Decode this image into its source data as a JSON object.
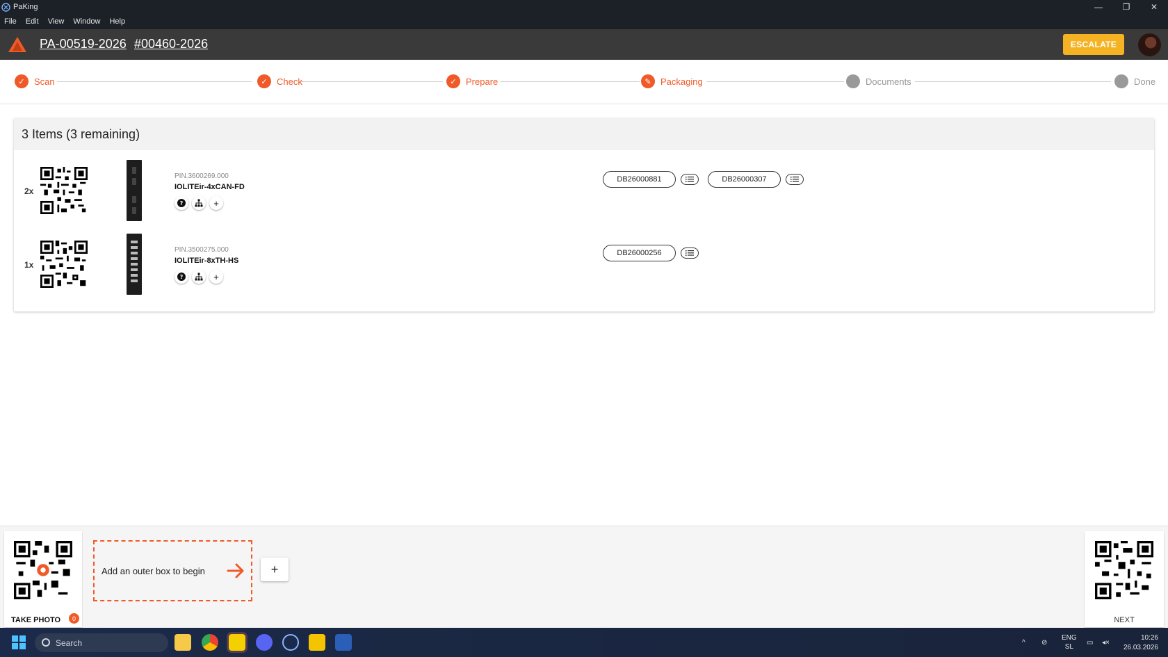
{
  "window": {
    "title": "PaKing",
    "minimize": "—",
    "restore": "❐",
    "close": "✕"
  },
  "menu": [
    "File",
    "Edit",
    "View",
    "Window",
    "Help"
  ],
  "header": {
    "order_id": "PA-00519-2026",
    "ticket_id": "#00460-2026",
    "escalate_label": "ESCALATE",
    "brand_color": "#f05a28",
    "escalate_color": "#f5b324"
  },
  "steps": [
    {
      "label": "Scan",
      "state": "done",
      "icon": "check-icon"
    },
    {
      "label": "Check",
      "state": "done",
      "icon": "check-icon"
    },
    {
      "label": "Prepare",
      "state": "done",
      "icon": "check-icon"
    },
    {
      "label": "Packaging",
      "state": "active",
      "icon": "pencil-icon"
    },
    {
      "label": "Documents",
      "state": "pending"
    },
    {
      "label": "Done",
      "state": "pending"
    }
  ],
  "items_card": {
    "title": "3 Items (3 remaining)",
    "items": [
      {
        "qty": "2x",
        "pin": "PIN.3600269.000",
        "name": "IOLITEir-4xCAN-FD",
        "serials": [
          "DB26000881",
          "DB26000307"
        ]
      },
      {
        "qty": "1x",
        "pin": "PIN.3500275.000",
        "name": "IOLITEir-8xTH-HS",
        "serials": [
          "DB26000256"
        ]
      }
    ],
    "action_icons": [
      "help-icon",
      "hierarchy-icon",
      "plus-icon"
    ],
    "plus_glyph": "+"
  },
  "bottom": {
    "take_photo_label": "TAKE PHOTO",
    "photo_count": "0",
    "dropzone_text": "Add an outer box to begin",
    "add_box_glyph": "+",
    "next_label": "NEXT"
  },
  "taskbar": {
    "search_placeholder": "Search",
    "lang_top": "ENG",
    "lang_bottom": "SL",
    "time": "10:26",
    "date": "26.03.2026"
  }
}
